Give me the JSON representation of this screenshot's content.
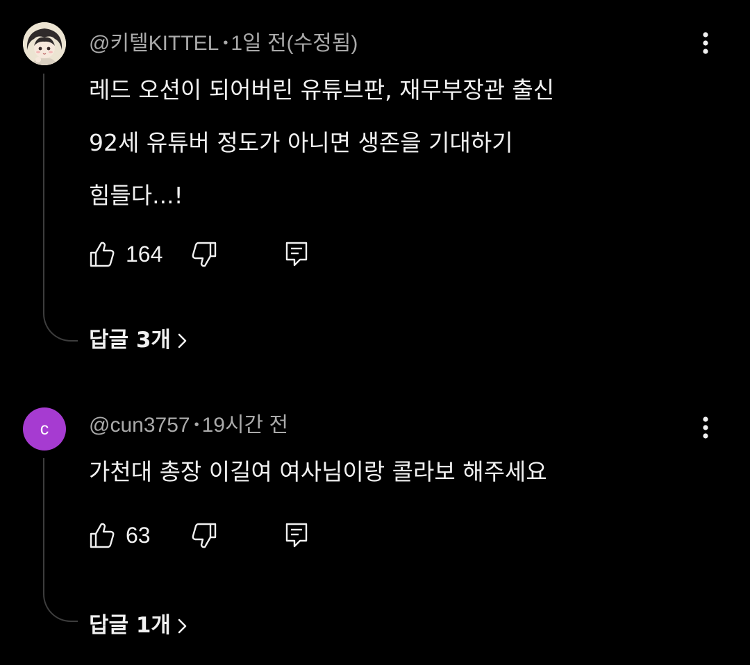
{
  "comments": [
    {
      "author": "@키텔KITTEL",
      "time": "1일 전(수정됨)",
      "text_lines": [
        "레드 오션이 되어버린 유튜브판, 재무부장관 출신",
        "92세 유튜버 정도가 아니면 생존을 기대하기",
        "힘들다...!"
      ],
      "likes": "164",
      "replies_label": "답글 3개",
      "avatar_icon": "anime-character-avatar"
    },
    {
      "author": "@cun3757",
      "time": "19시간 전",
      "avatar_letter": "c",
      "avatar_color": "#a63bd1",
      "text_lines": [
        "가천대 총장 이길여 여사님이랑 콜라보 해주세요"
      ],
      "likes": "63",
      "replies_label": "답글 1개"
    }
  ],
  "separator": "•",
  "icons": {
    "like": "thumbs-up-icon",
    "dislike": "thumbs-down-icon",
    "reply": "comment-reply-icon",
    "menu": "more-vert-icon",
    "expand": "chevron-right-icon"
  },
  "colors": {
    "background": "#000000",
    "text": "#f1f1f1",
    "secondary_text": "#aaaaaa",
    "thread_line": "#3d3d3d"
  }
}
